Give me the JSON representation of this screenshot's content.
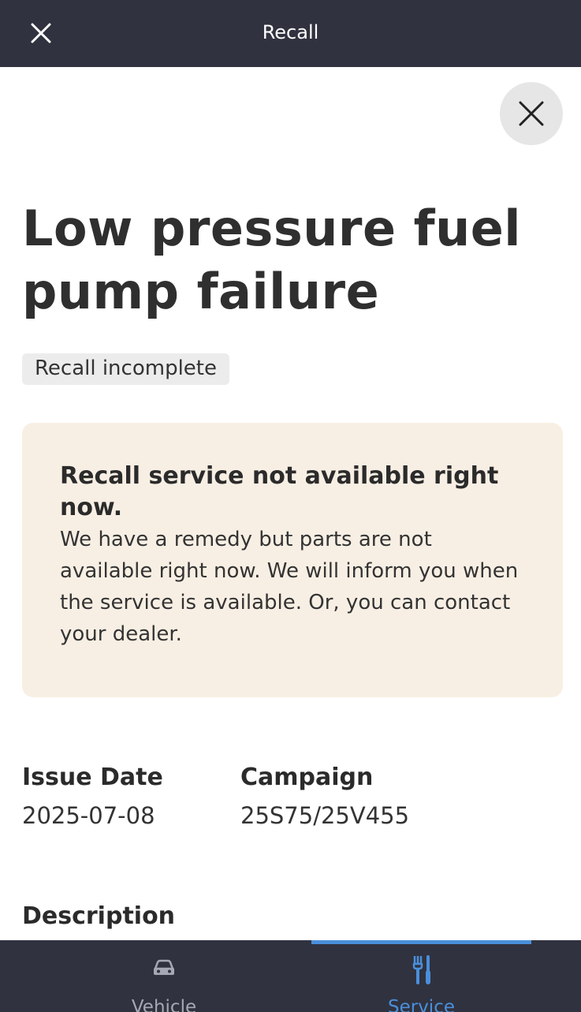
{
  "header": {
    "title": "Recall",
    "close_icon": "close-icon"
  },
  "dismiss": {
    "icon": "close-icon"
  },
  "recall": {
    "title": "Low pressure fuel pump failure",
    "status": "Recall incomplete",
    "alert": {
      "heading": "Recall service not available right now.",
      "body": "We have a remedy but parts are not available right now. We will inform you when the service is available. Or, you can contact your dealer."
    },
    "issue_date_label": "Issue Date",
    "issue_date": "2025-07-08",
    "campaign_label": "Campaign",
    "campaign": "25S75/25V455",
    "description_label": "Description"
  },
  "bottom_nav": {
    "active": "service",
    "tabs": [
      {
        "id": "vehicle",
        "label": "Vehicle",
        "icon": "car-icon"
      },
      {
        "id": "service",
        "label": "Service",
        "icon": "tools-icon"
      }
    ]
  },
  "colors": {
    "bar_background": "#30323f",
    "accent": "#4a8fdb",
    "alert_background": "#f8efe4",
    "badge_background": "#ececec"
  }
}
